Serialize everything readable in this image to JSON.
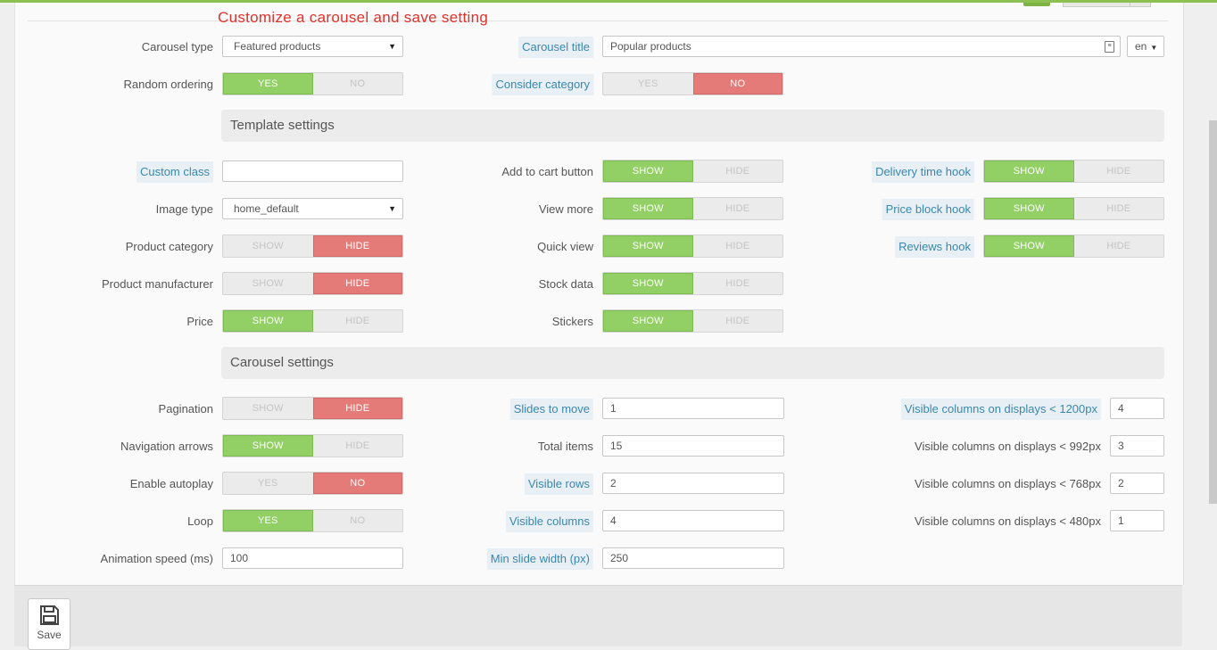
{
  "annotation": "Customize a carousel and save setting",
  "general": {
    "carousel_type": {
      "label": "Carousel type",
      "value": "Featured products"
    },
    "carousel_title": {
      "label": "Carousel title",
      "value": "Popular products",
      "lang": "en"
    },
    "random_ordering": {
      "label": "Random ordering",
      "on": "YES",
      "off": "NO",
      "active": "on"
    },
    "consider_category": {
      "label": "Consider category",
      "on": "YES",
      "off": "NO",
      "active": "off"
    }
  },
  "template_section": "Template settings",
  "template": {
    "custom_class": {
      "label": "Custom class",
      "value": ""
    },
    "image_type": {
      "label": "Image type",
      "value": "home_default"
    },
    "product_category": {
      "label": "Product category",
      "on": "SHOW",
      "off": "HIDE",
      "active": "off"
    },
    "product_manufacturer": {
      "label": "Product manufacturer",
      "on": "SHOW",
      "off": "HIDE",
      "active": "off"
    },
    "price": {
      "label": "Price",
      "on": "SHOW",
      "off": "HIDE",
      "active": "on"
    },
    "add_to_cart": {
      "label": "Add to cart button",
      "on": "SHOW",
      "off": "HIDE",
      "active": "on"
    },
    "view_more": {
      "label": "View more",
      "on": "SHOW",
      "off": "HIDE",
      "active": "on"
    },
    "quick_view": {
      "label": "Quick view",
      "on": "SHOW",
      "off": "HIDE",
      "active": "on"
    },
    "stock_data": {
      "label": "Stock data",
      "on": "SHOW",
      "off": "HIDE",
      "active": "on"
    },
    "stickers": {
      "label": "Stickers",
      "on": "SHOW",
      "off": "HIDE",
      "active": "on"
    },
    "delivery_time_hook": {
      "label": "Delivery time hook",
      "on": "SHOW",
      "off": "HIDE",
      "active": "on"
    },
    "price_block_hook": {
      "label": "Price block hook",
      "on": "SHOW",
      "off": "HIDE",
      "active": "on"
    },
    "reviews_hook": {
      "label": "Reviews hook",
      "on": "SHOW",
      "off": "HIDE",
      "active": "on"
    }
  },
  "carousel_section": "Carousel settings",
  "carousel": {
    "pagination": {
      "label": "Pagination",
      "on": "SHOW",
      "off": "HIDE",
      "active": "off"
    },
    "navigation_arrows": {
      "label": "Navigation arrows",
      "on": "SHOW",
      "off": "HIDE",
      "active": "on"
    },
    "enable_autoplay": {
      "label": "Enable autoplay",
      "on": "YES",
      "off": "NO",
      "active": "off"
    },
    "loop": {
      "label": "Loop",
      "on": "YES",
      "off": "NO",
      "active": "on"
    },
    "animation_speed": {
      "label": "Animation speed (ms)",
      "value": "100"
    },
    "slides_to_move": {
      "label": "Slides to move",
      "value": "1"
    },
    "total_items": {
      "label": "Total items",
      "value": "15"
    },
    "visible_rows": {
      "label": "Visible rows",
      "value": "2"
    },
    "visible_columns": {
      "label": "Visible columns",
      "value": "4"
    },
    "min_slide_width": {
      "label": "Min slide width (px)",
      "value": "250"
    },
    "cols_1200": {
      "label": "Visible columns on displays < 1200px",
      "value": "4"
    },
    "cols_992": {
      "label": "Visible columns on displays < 992px",
      "value": "3"
    },
    "cols_768": {
      "label": "Visible columns on displays < 768px",
      "value": "2"
    },
    "cols_480": {
      "label": "Visible columns on displays < 480px",
      "value": "1"
    }
  },
  "footer": {
    "save_label": "Save"
  },
  "colors": {
    "accent_green": "#92d065",
    "accent_red": "#e47b78",
    "annotation": "#e0312b",
    "help_label": "#3a87ad"
  }
}
